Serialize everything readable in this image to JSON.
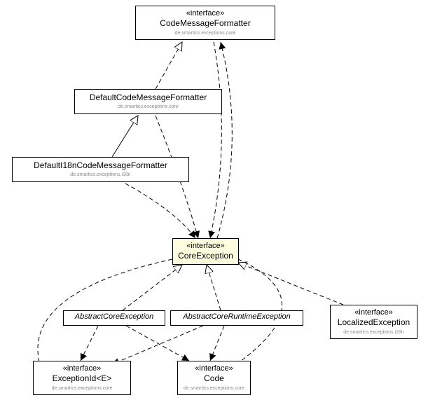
{
  "diagram": {
    "type": "uml-class-diagram",
    "nodes": {
      "codeMessageFormatter": {
        "stereotype": "«interface»",
        "name": "CodeMessageFormatter",
        "package": "de.smartics.exceptions.core"
      },
      "defaultCodeMessageFormatter": {
        "name": "DefaultCodeMessageFormatter",
        "package": "de.smartics.exceptions.core"
      },
      "defaultI18nCodeMessageFormatter": {
        "name": "DefaultI18nCodeMessageFormatter",
        "package": "de.smartics.exceptions.i18n"
      },
      "coreException": {
        "stereotype": "«interface»",
        "name": "CoreException"
      },
      "abstractCoreException": {
        "name": "AbstractCoreException"
      },
      "abstractCoreRuntimeException": {
        "name": "AbstractCoreRuntimeException"
      },
      "localizedException": {
        "stereotype": "«interface»",
        "name": "LocalizedException",
        "package": "de.smartics.exceptions.i18n"
      },
      "exceptionId": {
        "stereotype": "«interface»",
        "name": "ExceptionId<E>",
        "package": "de.smartics.exceptions.core"
      },
      "code": {
        "stereotype": "«interface»",
        "name": "Code",
        "package": "de.smartics.exceptions.core"
      }
    }
  }
}
